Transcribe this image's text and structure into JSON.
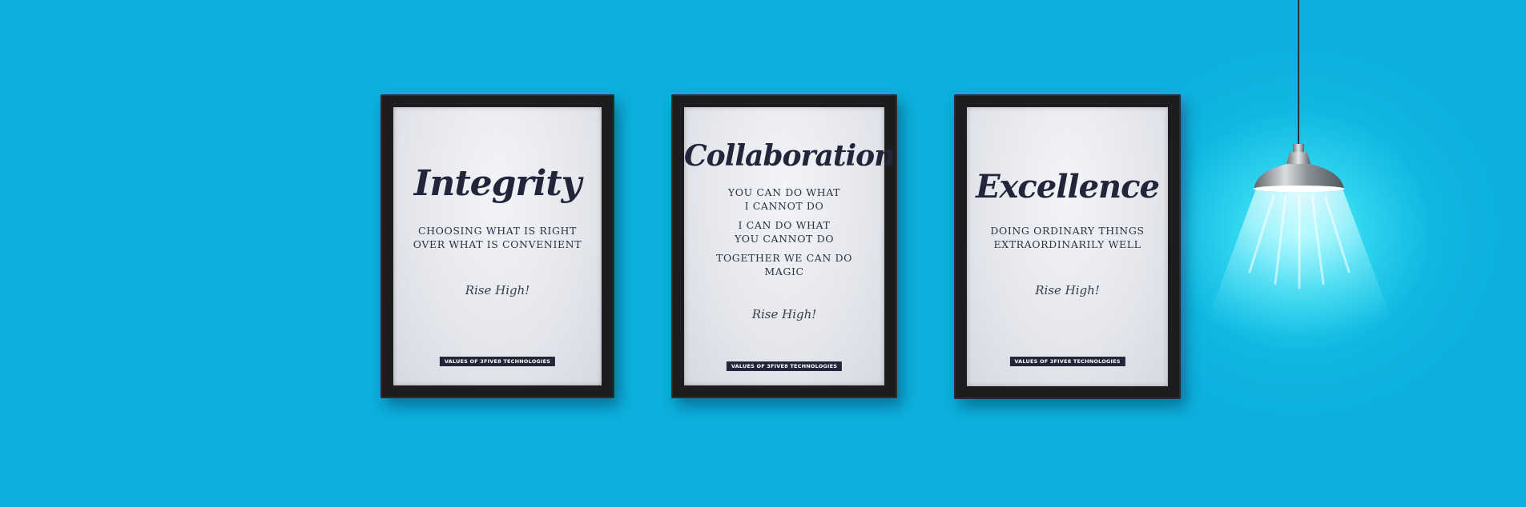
{
  "frames": [
    {
      "title": "Integrity",
      "lines": [
        "CHOOSING WHAT IS RIGHT",
        "OVER WHAT IS CONVENIENT"
      ],
      "tagline": "Rise High!",
      "badge": "VALUES OF 3FIVE8 TECHNOLOGIES"
    },
    {
      "title": "Collaboration",
      "lines": [
        "YOU CAN DO WHAT",
        "I CANNOT DO",
        "I CAN DO WHAT",
        "YOU CANNOT DO",
        "TOGETHER WE CAN DO",
        "MAGIC"
      ],
      "tagline": "Rise High!",
      "badge": "VALUES OF 3FIVE8 TECHNOLOGIES"
    },
    {
      "title": "Excellence",
      "lines": [
        "DOING ORDINARY THINGS",
        "EXTRAORDINARILY WELL"
      ],
      "tagline": "Rise High!",
      "badge": "VALUES OF 3FIVE8 TECHNOLOGIES"
    }
  ],
  "colors": {
    "wall": "#0cb0dd",
    "frame": "#1d1d1f",
    "ink": "#23263a",
    "light_glow": "#8cfaff"
  },
  "icons": [
    "pendant-lamp-icon"
  ]
}
